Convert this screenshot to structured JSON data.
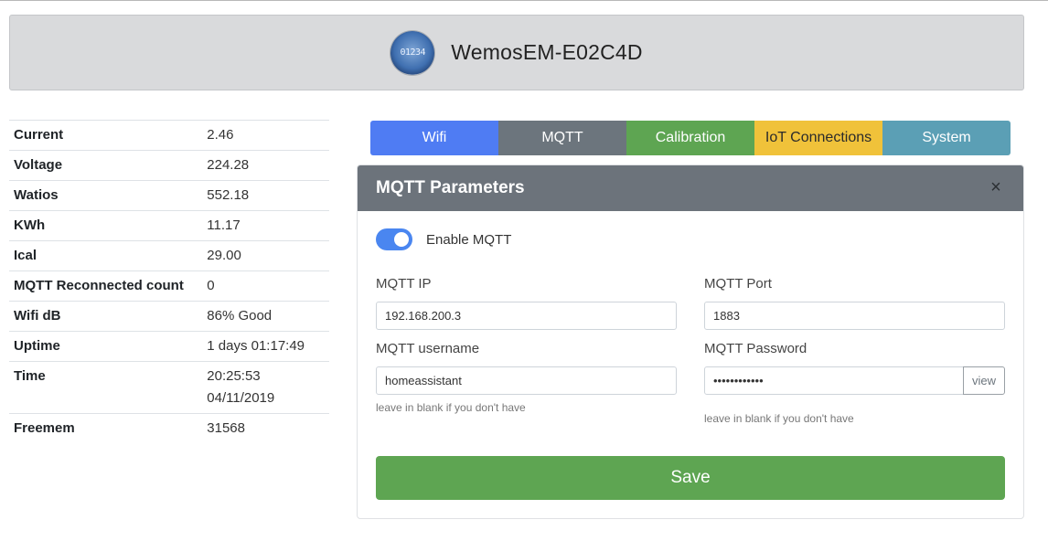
{
  "header": {
    "logo_text": "01234",
    "device_name": "WemosEM-E02C4D"
  },
  "stats": [
    {
      "key": "Current",
      "value": "2.46"
    },
    {
      "key": "Voltage",
      "value": "224.28"
    },
    {
      "key": "Watios",
      "value": "552.18"
    },
    {
      "key": "KWh",
      "value": "11.17"
    },
    {
      "key": "Ical",
      "value": "29.00"
    },
    {
      "key": "MQTT Reconnected count",
      "value": "0"
    },
    {
      "key": "Wifi dB",
      "value": "86% Good"
    },
    {
      "key": "Uptime",
      "value": "1 days 01:17:49"
    },
    {
      "key": "Time",
      "value": "20:25:53 04/11/2019"
    },
    {
      "key": "Freemem",
      "value": "31568"
    }
  ],
  "tabs": [
    {
      "label": "Wifi"
    },
    {
      "label": "MQTT"
    },
    {
      "label": "Calibration"
    },
    {
      "label": "IoT Connections"
    },
    {
      "label": "System"
    }
  ],
  "card": {
    "title": "MQTT Parameters",
    "close_glyph": "×",
    "enable_label": "Enable MQTT",
    "enabled": true,
    "ip_label": "MQTT IP",
    "ip_value": "192.168.200.3",
    "port_label": "MQTT Port",
    "port_value": "1883",
    "username_label": "MQTT username",
    "username_value": "homeassistant",
    "username_hint": "leave in blank if you don't have",
    "password_label": "MQTT Password",
    "password_value": "••••••••••••",
    "password_view": "view",
    "password_hint": "leave in blank if you don't have",
    "save_label": "Save"
  }
}
